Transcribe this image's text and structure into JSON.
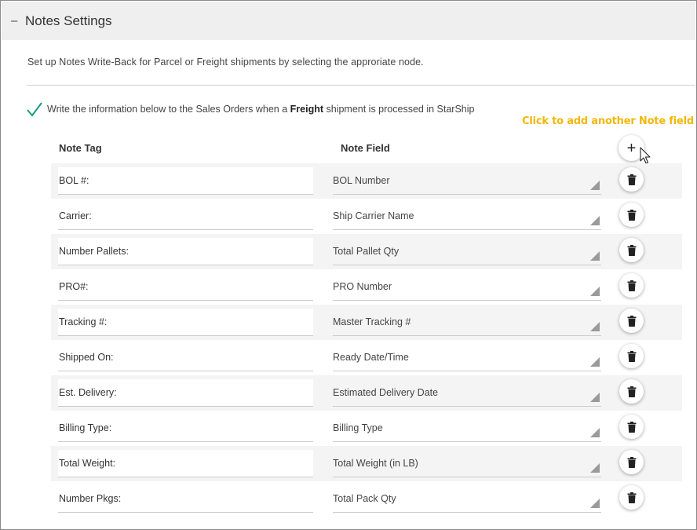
{
  "header": {
    "title": "Notes Settings",
    "collapse_icon": "minus-icon"
  },
  "description": "Set up Notes Write-Back for Parcel or Freight shipments by selecting the approriate node.",
  "writeback": {
    "checked": true,
    "text_before": "Write the information below to the Sales Orders when a ",
    "text_bold": "Freight",
    "text_after": " shipment is processed in StarShip"
  },
  "callout": "Click to add another Note field",
  "columns": {
    "note_tag": "Note Tag",
    "note_field": "Note Field"
  },
  "rows": [
    {
      "tag": "BOL #:",
      "field": "BOL Number"
    },
    {
      "tag": "Carrier:",
      "field": "Ship Carrier Name"
    },
    {
      "tag": "Number Pallets:",
      "field": "Total Pallet Qty"
    },
    {
      "tag": "PRO#:",
      "field": "PRO Number"
    },
    {
      "tag": "Tracking #:",
      "field": "Master Tracking #"
    },
    {
      "tag": "Shipped On:",
      "field": "Ready Date/Time"
    },
    {
      "tag": "Est. Delivery:",
      "field": "Estimated Delivery Date"
    },
    {
      "tag": "Billing Type:",
      "field": "Billing Type"
    },
    {
      "tag": "Total Weight:",
      "field": "Total Weight (in LB)"
    },
    {
      "tag": "Number Pkgs:",
      "field": "Total Pack Qty"
    }
  ],
  "colors": {
    "check": "#1a9b83",
    "callout": "#f2b705",
    "shaded_row": "#f4f4f4"
  }
}
